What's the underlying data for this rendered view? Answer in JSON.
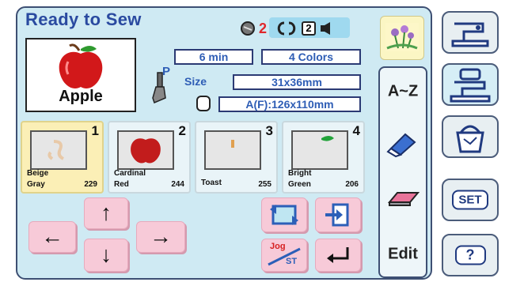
{
  "screen": {
    "title": "Ready to Sew",
    "status": {
      "red_count": "2",
      "box_count": "2"
    },
    "preview": {
      "label": "Apple"
    },
    "info": {
      "time": "6 min",
      "colors": "4 Colors",
      "size_label": "Size",
      "size_value": "31x36mm",
      "hoop": "A(F):126x110mm",
      "presser_foot": "P"
    },
    "threads": [
      {
        "num": "1",
        "name_line1": "Beige",
        "name_line2": "Gray",
        "code": "229",
        "color": "#e8c9a8"
      },
      {
        "num": "2",
        "name_line1": "Cardinal",
        "name_line2": "Red",
        "code": "244",
        "color": "#c21c1c"
      },
      {
        "num": "3",
        "name_line1": "Toast",
        "name_line2": "",
        "code": "255",
        "color": "#e0a050"
      },
      {
        "num": "4",
        "name_line1": "Bright",
        "name_line2": "Green",
        "code": "206",
        "color": "#22a33a"
      }
    ],
    "controls": {
      "jog_label": "Jog",
      "st_label": "ST"
    },
    "tabs": {
      "az": "A~Z",
      "edit": "Edit"
    },
    "right": {
      "set": "SET",
      "help": "?"
    },
    "colors": {
      "panel": "#cfeaf3",
      "accent_blue": "#2e5db5",
      "pink_button": "#f7cad8"
    }
  }
}
